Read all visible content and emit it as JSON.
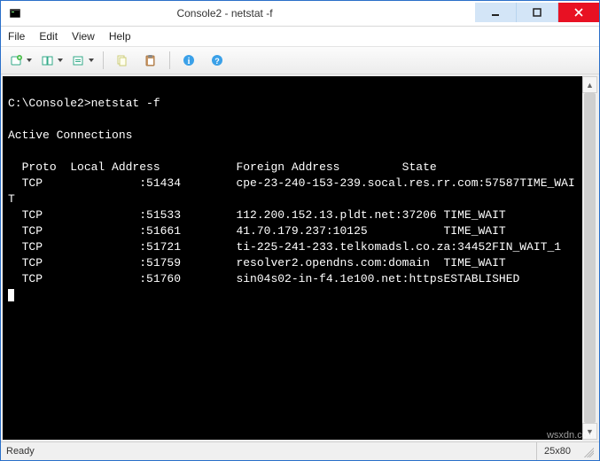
{
  "window": {
    "title": "Console2 - netstat  -f"
  },
  "menu": {
    "file": "File",
    "edit": "Edit",
    "view": "View",
    "help": "Help"
  },
  "console": {
    "prompt": "C:\\Console2>",
    "command": "netstat -f",
    "header": "Active Connections",
    "col_proto": "Proto",
    "col_local": "Local Address",
    "col_foreign": "Foreign Address",
    "col_state": "State",
    "rows": [
      {
        "proto": "TCP",
        "local": "           ",
        "port": ":51434",
        "foreign": "cpe-23-240-153-239.socal.res.rr.com:57587",
        "state": "TIME_WAIT",
        "wrap": true
      },
      {
        "proto": "TCP",
        "local": "           ",
        "port": ":51533",
        "foreign": "112.200.152.13.pldt.net:37206",
        "state": "TIME_WAIT",
        "wrap": false
      },
      {
        "proto": "TCP",
        "local": "           ",
        "port": ":51661",
        "foreign": "41.70.179.237:10125",
        "state": "TIME_WAIT",
        "wrap": false
      },
      {
        "proto": "TCP",
        "local": "           ",
        "port": ":51721",
        "foreign": "ti-225-241-233.telkomadsl.co.za:34452",
        "state": "FIN_WAIT_1",
        "wrap": true
      },
      {
        "proto": "TCP",
        "local": "           ",
        "port": ":51759",
        "foreign": "resolver2.opendns.com:domain",
        "state": "TIME_WAIT",
        "wrap": false
      },
      {
        "proto": "TCP",
        "local": "           ",
        "port": ":51760",
        "foreign": "sin04s02-in-f4.1e100.net:https",
        "state": "ESTABLISHED",
        "wrap": false
      }
    ]
  },
  "status": {
    "ready": "Ready",
    "dims": "25x80"
  },
  "watermark": "wsxdn.com"
}
